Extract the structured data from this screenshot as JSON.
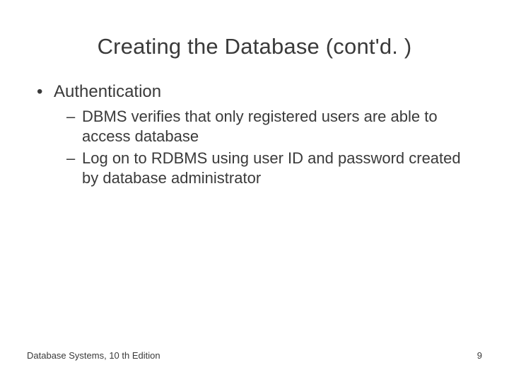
{
  "title": "Creating the Database (cont'd. )",
  "bullets": {
    "l1_0": "Authentication",
    "l2_0": "DBMS verifies that only registered users are able to access database",
    "l2_1": "Log on to RDBMS using user ID and password created by database administrator"
  },
  "footer": {
    "left": "Database Systems, 10 th Edition",
    "right": "9"
  }
}
